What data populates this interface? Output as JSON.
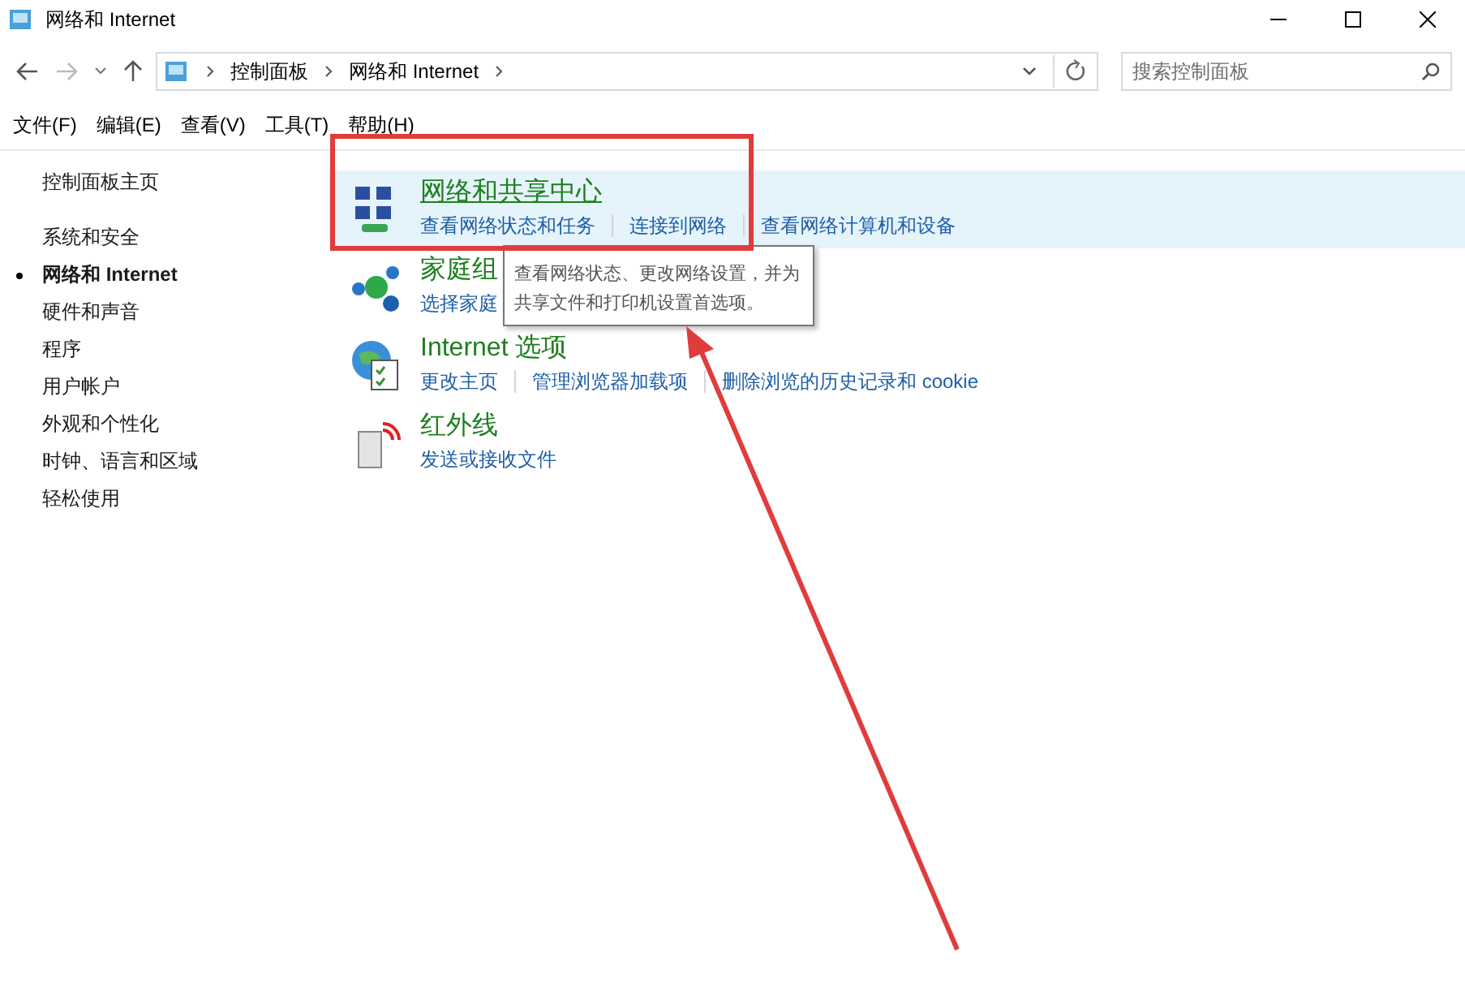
{
  "window": {
    "title": "网络和 Internet"
  },
  "address_bar": {
    "breadcrumbs": [
      "控制面板",
      "网络和 Internet"
    ]
  },
  "search": {
    "placeholder": "搜索控制面板"
  },
  "menu": [
    "文件(F)",
    "编辑(E)",
    "查看(V)",
    "工具(T)",
    "帮助(H)"
  ],
  "sidebar": {
    "home": "控制面板主页",
    "items": [
      {
        "label": "系统和安全",
        "selected": false
      },
      {
        "label": "网络和 Internet",
        "selected": true
      },
      {
        "label": "硬件和声音",
        "selected": false
      },
      {
        "label": "程序",
        "selected": false
      },
      {
        "label": "用户帐户",
        "selected": false
      },
      {
        "label": "外观和个性化",
        "selected": false
      },
      {
        "label": "时钟、语言和区域",
        "selected": false
      },
      {
        "label": "轻松使用",
        "selected": false
      }
    ]
  },
  "categories": [
    {
      "kind": "network",
      "title": "网络和共享中心",
      "highlighted": true,
      "links": [
        "查看网络状态和任务",
        "连接到网络",
        "查看网络计算机和设备"
      ]
    },
    {
      "kind": "homegroup",
      "title": "家庭组",
      "highlighted": false,
      "links": [
        "选择家庭"
      ]
    },
    {
      "kind": "internet",
      "title": "Internet 选项",
      "highlighted": false,
      "links": [
        "更改主页",
        "管理浏览器加载项",
        "删除浏览的历史记录和 cookie"
      ]
    },
    {
      "kind": "infrared",
      "title": "红外线",
      "highlighted": false,
      "links": [
        "发送或接收文件"
      ]
    }
  ],
  "tooltip": {
    "text": "查看网络状态、更改网络设置，并为共享文件和打印机设置首选项。"
  }
}
